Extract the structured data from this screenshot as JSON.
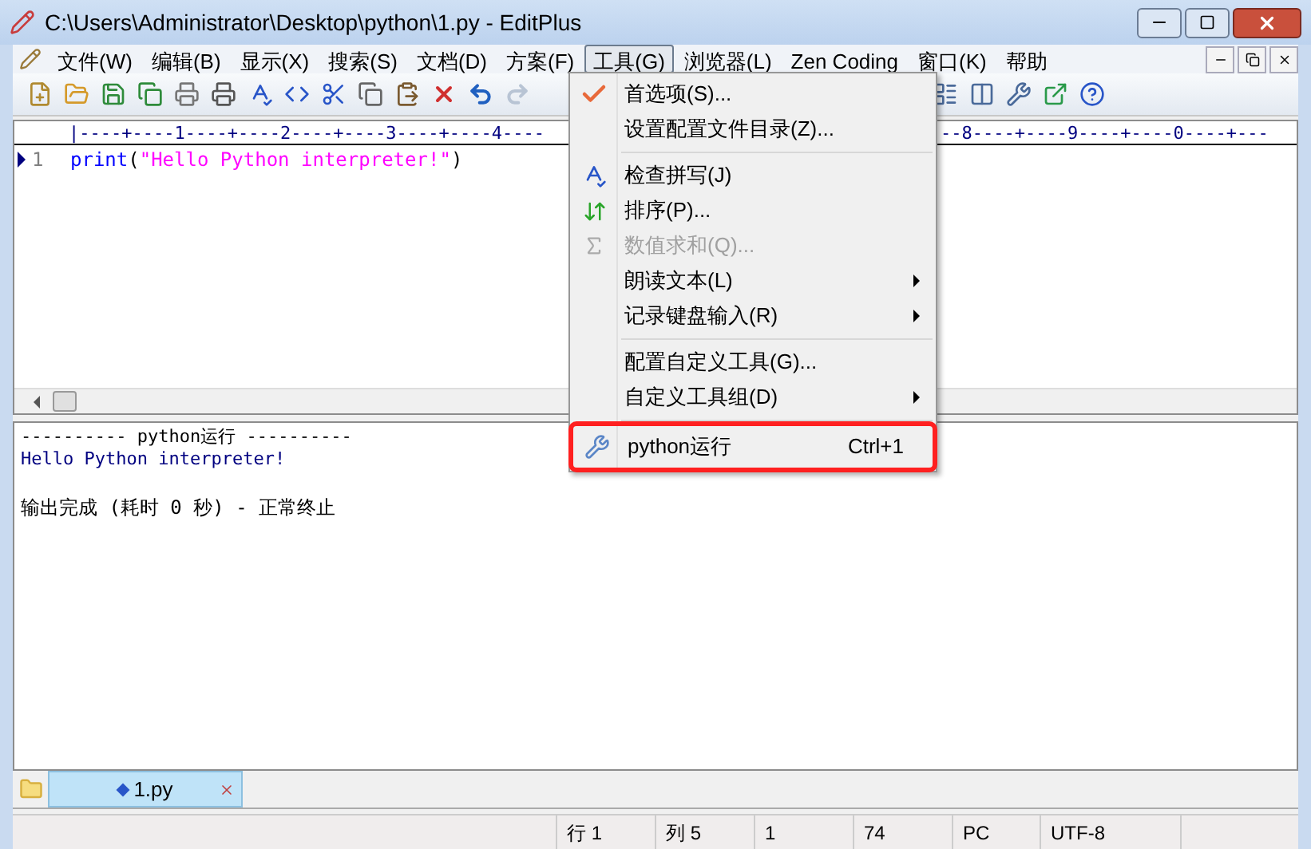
{
  "window": {
    "title": "C:\\Users\\Administrator\\Desktop\\python\\1.py - EditPlus"
  },
  "menu_bar": [
    {
      "label": "文件(W)",
      "selected": false
    },
    {
      "label": "编辑(B)",
      "selected": false
    },
    {
      "label": "显示(X)",
      "selected": false
    },
    {
      "label": "搜索(S)",
      "selected": false
    },
    {
      "label": "文档(D)",
      "selected": false
    },
    {
      "label": "方案(F)",
      "selected": false
    },
    {
      "label": "工具(G)",
      "selected": true
    },
    {
      "label": "浏览器(L)",
      "selected": false
    },
    {
      "label": "Zen Coding",
      "selected": false
    },
    {
      "label": "窗口(K)",
      "selected": false
    },
    {
      "label": "帮助",
      "selected": false
    }
  ],
  "ruler": {
    "left": "|----+----1----+----2----+----3----+----4----",
    "right": "--8----+----9----+----0----+---"
  },
  "editor": {
    "lines": [
      {
        "number": "1",
        "tokens": [
          {
            "text": "print",
            "kind": "keyword"
          },
          {
            "text": "(",
            "kind": "punct"
          },
          {
            "text": "\"Hello Python interpreter!\"",
            "kind": "string"
          },
          {
            "text": ")",
            "kind": "punct"
          }
        ]
      }
    ]
  },
  "output": {
    "lines": [
      {
        "text": "---------- python运行 ----------",
        "kind": "header"
      },
      {
        "text": "Hello Python interpreter!",
        "kind": "result"
      },
      {
        "text": "输出完成 (耗时 0 秒) - 正常终止",
        "kind": "status"
      }
    ]
  },
  "tools_menu": {
    "groups": [
      [
        {
          "label": "首选项(S)...",
          "disabled": false,
          "submenu": false,
          "outlined": false
        },
        {
          "label": "设置配置文件目录(Z)...",
          "disabled": false,
          "submenu": false,
          "outlined": false
        }
      ],
      [
        {
          "label": "检查拼写(J)",
          "disabled": false,
          "submenu": false,
          "outlined": false
        },
        {
          "label": "排序(P)...",
          "disabled": false,
          "submenu": false,
          "outlined": false
        },
        {
          "label": "数值求和(Q)...",
          "disabled": true,
          "submenu": false,
          "outlined": false
        },
        {
          "label": "朗读文本(L)",
          "disabled": false,
          "submenu": true,
          "outlined": false
        },
        {
          "label": "记录键盘输入(R)",
          "disabled": false,
          "submenu": true,
          "outlined": false
        }
      ],
      [
        {
          "label": "配置自定义工具(G)...",
          "disabled": false,
          "submenu": false,
          "outlined": false
        },
        {
          "label": "自定义工具组(D)",
          "disabled": false,
          "submenu": true,
          "outlined": false
        }
      ],
      [
        {
          "label": "python运行",
          "shortcut": "Ctrl+1",
          "disabled": false,
          "submenu": false,
          "outlined": true
        }
      ]
    ]
  },
  "tabs": [
    {
      "label": "1.py",
      "selected": true
    }
  ],
  "status_bar": [
    "行 1",
    "列 5",
    "1",
    "74",
    "PC",
    "UTF-8"
  ]
}
